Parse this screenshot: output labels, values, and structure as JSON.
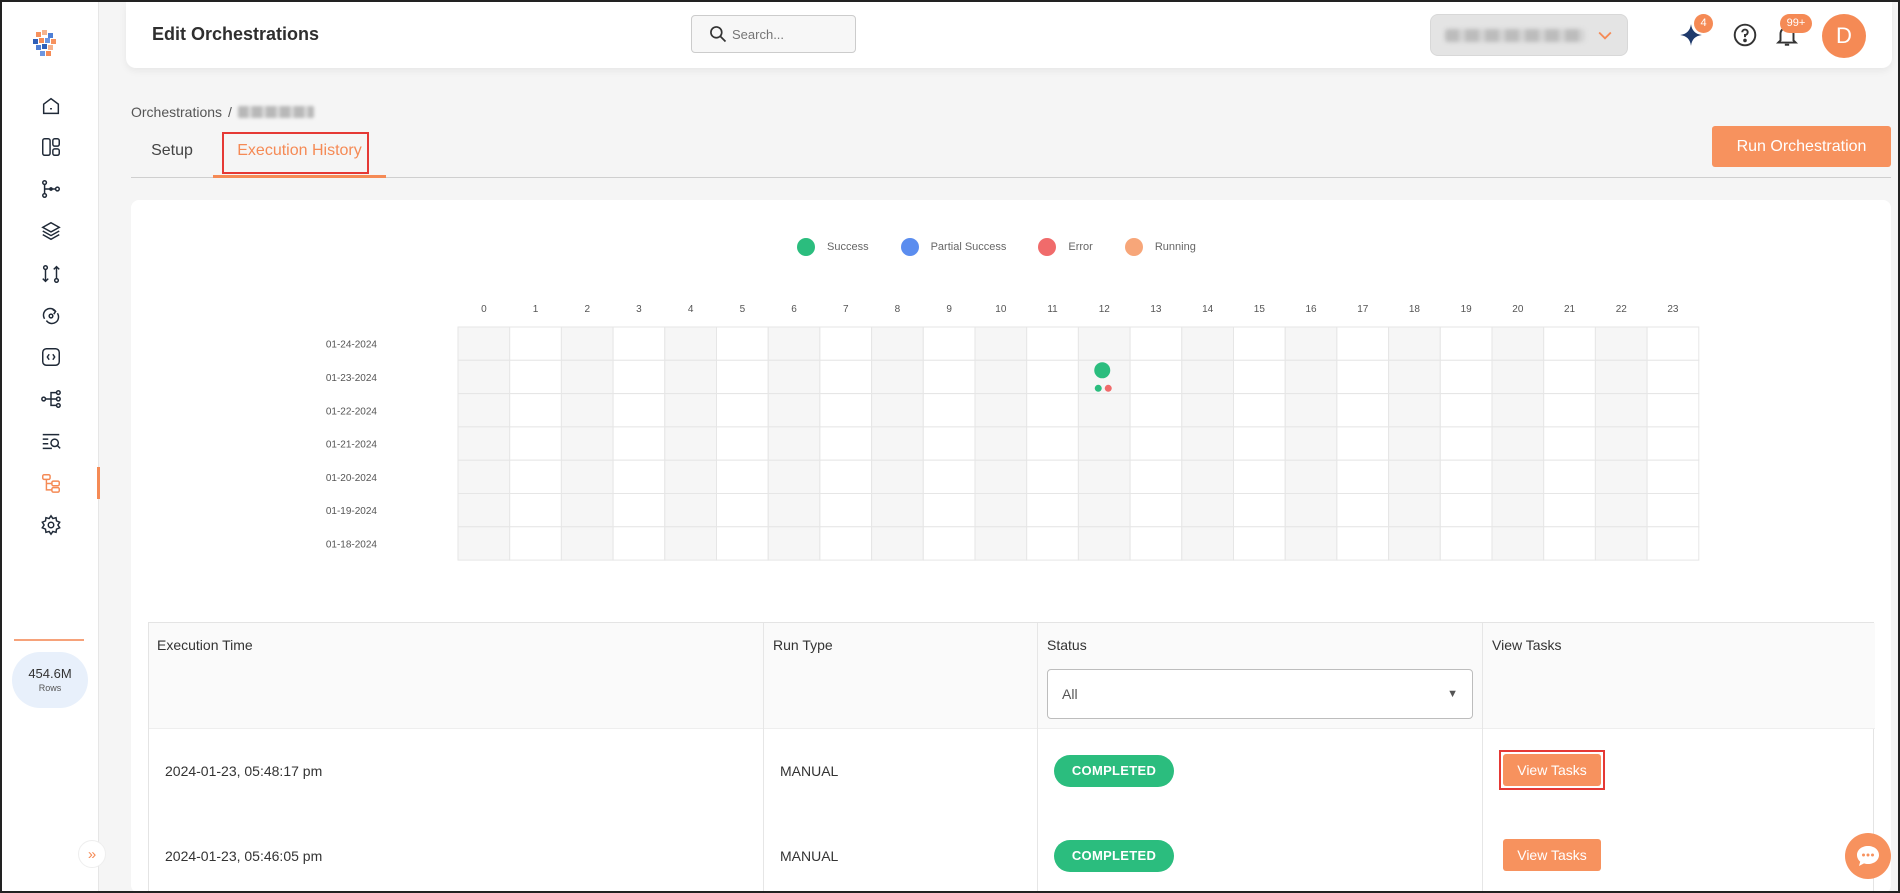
{
  "header": {
    "title": "Edit Orchestrations",
    "search_placeholder": "Search...",
    "ai_badge": "4",
    "notif_badge": "99+",
    "avatar_letter": "D"
  },
  "sidebar": {
    "items": [
      "home-icon",
      "dashboard-icon",
      "pipeline-icon",
      "layers-icon",
      "transform-icon",
      "sync-icon",
      "code-icon",
      "lineage-icon",
      "query-icon",
      "orchestration-icon",
      "settings-icon"
    ],
    "active": "orchestration-icon",
    "rows_value": "454.6M",
    "rows_label": "Rows"
  },
  "breadcrumb": {
    "root": "Orchestrations",
    "separator": "/"
  },
  "tabs": [
    {
      "label": "Setup"
    },
    {
      "label": "Execution History"
    }
  ],
  "run_button": "Run Orchestration",
  "legend": [
    {
      "label": "Success",
      "color": "#2bbd7e"
    },
    {
      "label": "Partial Success",
      "color": "#5b8def"
    },
    {
      "label": "Error",
      "color": "#f06b6b"
    },
    {
      "label": "Running",
      "color": "#f7a679"
    }
  ],
  "heatmap": {
    "hours": [
      "0",
      "1",
      "2",
      "3",
      "4",
      "5",
      "6",
      "7",
      "8",
      "9",
      "10",
      "11",
      "12",
      "13",
      "14",
      "15",
      "16",
      "17",
      "18",
      "19",
      "20",
      "21",
      "22",
      "23"
    ],
    "dates": [
      "01-24-2024",
      "01-23-2024",
      "01-22-2024",
      "01-21-2024",
      "01-20-2024",
      "01-19-2024",
      "01-18-2024"
    ],
    "markers": [
      {
        "date": "01-23-2024",
        "hour": 12,
        "status": "success",
        "size": "large"
      },
      {
        "date": "01-23-2024",
        "hour": 12,
        "status": "success",
        "size": "small"
      },
      {
        "date": "01-23-2024",
        "hour": 12,
        "status": "error",
        "size": "small"
      }
    ]
  },
  "table": {
    "headers": {
      "execution_time": "Execution Time",
      "run_type": "Run Type",
      "status": "Status",
      "view_tasks": "View Tasks"
    },
    "status_filter": "All",
    "rows": [
      {
        "time": "2024-01-23, 05:48:17 pm",
        "run_type": "MANUAL",
        "status": "COMPLETED",
        "action": "View Tasks"
      },
      {
        "time": "2024-01-23, 05:46:05 pm",
        "run_type": "MANUAL",
        "status": "COMPLETED",
        "action": "View Tasks"
      }
    ]
  },
  "colors": {
    "accent": "#f58a55",
    "success": "#2bbd7e",
    "highlight": "#e53935"
  }
}
